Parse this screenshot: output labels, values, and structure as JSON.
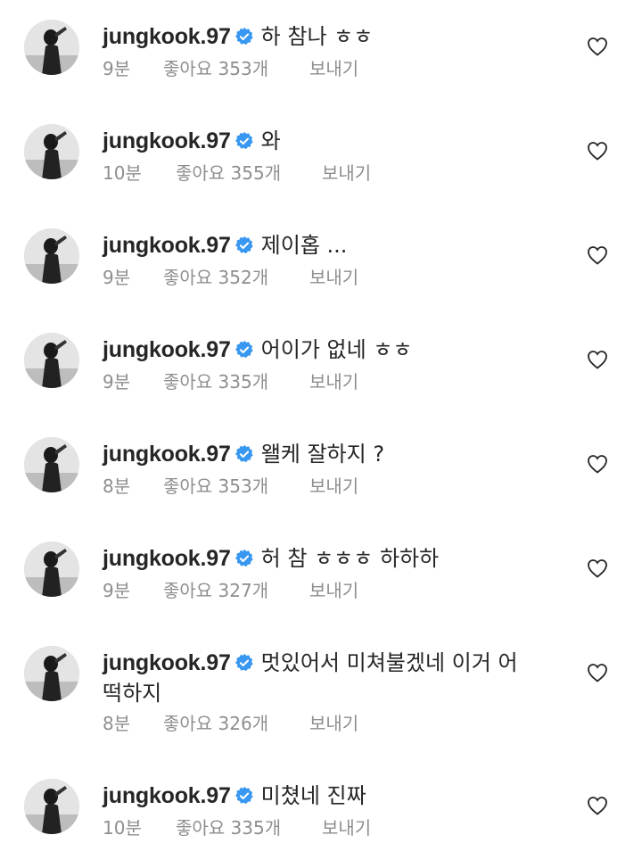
{
  "comments": [
    {
      "username": "jungkook.97",
      "text": "하 참나 ㅎㅎ",
      "time": "9분",
      "likes": "좋아요 353개",
      "reply": "보내기"
    },
    {
      "username": "jungkook.97",
      "text": "와",
      "time": "10분",
      "likes": "좋아요 355개",
      "reply": "보내기"
    },
    {
      "username": "jungkook.97",
      "text": "제이홉 ...",
      "time": "9분",
      "likes": "좋아요 352개",
      "reply": "보내기"
    },
    {
      "username": "jungkook.97",
      "text": "어이가 없네 ㅎㅎ",
      "time": "9분",
      "likes": "좋아요 335개",
      "reply": "보내기"
    },
    {
      "username": "jungkook.97",
      "text": "왤케 잘하지 ?",
      "time": "8분",
      "likes": "좋아요 353개",
      "reply": "보내기"
    },
    {
      "username": "jungkook.97",
      "text": "허 참 ㅎㅎㅎ 하하하",
      "time": "9분",
      "likes": "좋아요 327개",
      "reply": "보내기"
    },
    {
      "username": "jungkook.97",
      "text": "멋있어서 미쳐불겠네 이거 어떡하지",
      "time": "8분",
      "likes": "좋아요 326개",
      "reply": "보내기"
    },
    {
      "username": "jungkook.97",
      "text": "미쳤네 진짜",
      "time": "10분",
      "likes": "좋아요 335개",
      "reply": "보내기"
    }
  ],
  "colors": {
    "verified": "#3897f0",
    "meta_text": "#8e8e8e",
    "main_text": "#262626"
  }
}
